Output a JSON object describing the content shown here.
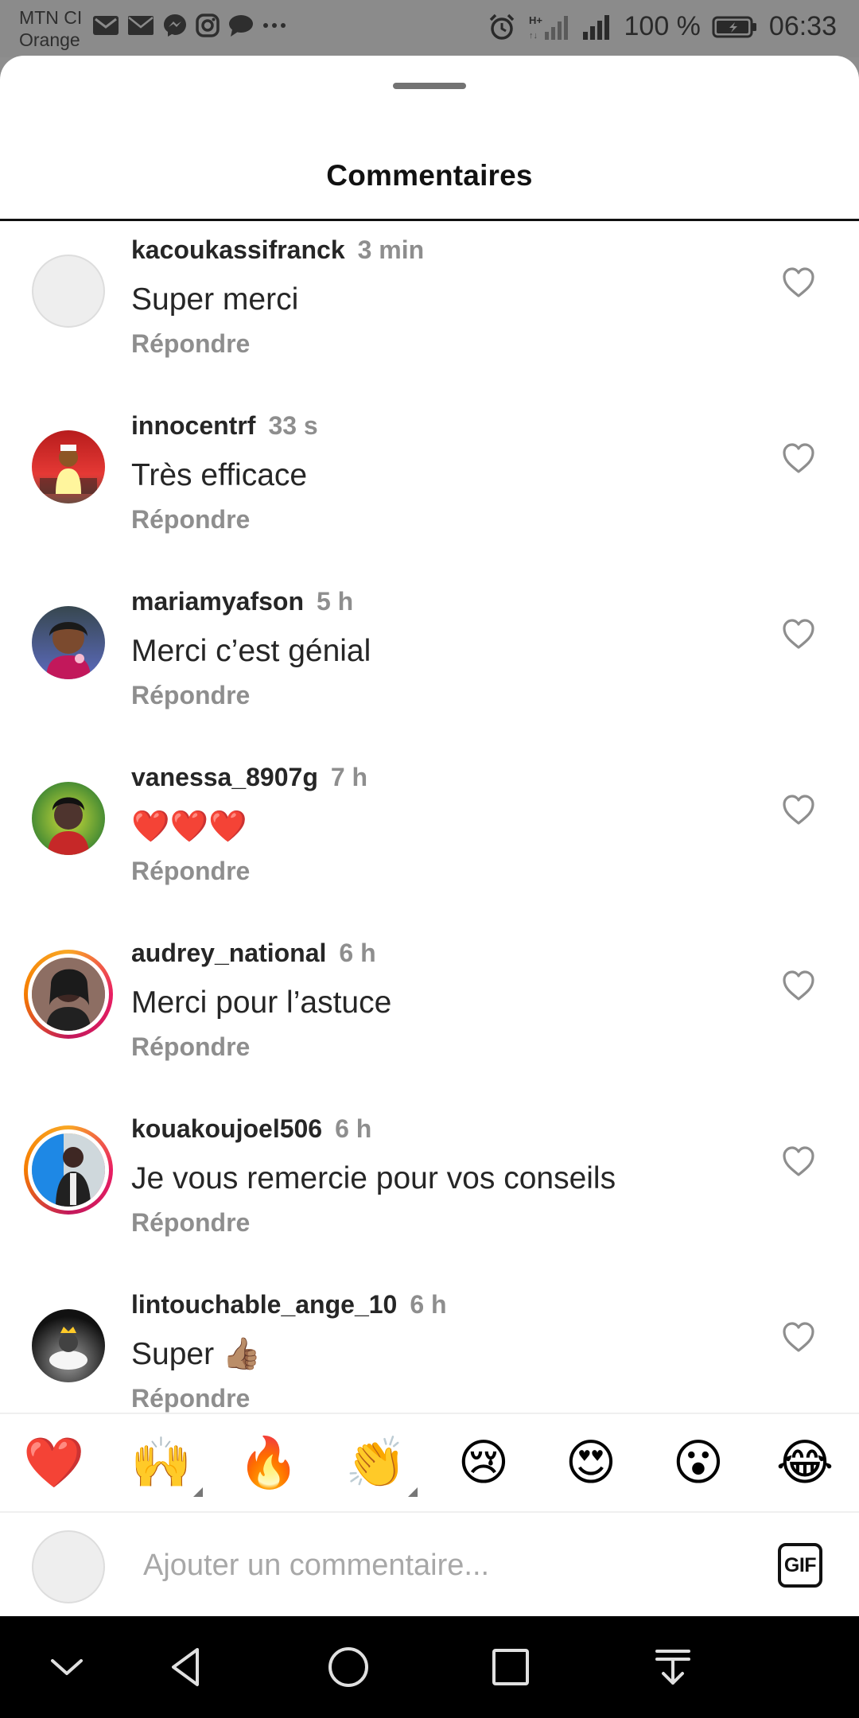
{
  "status_bar": {
    "carrier_line1": "MTN CI",
    "carrier_line2": "Orange",
    "battery_text": "100 %",
    "time": "06:33",
    "notification_icons": [
      "gmail-icon",
      "mail-icon",
      "messenger-icon",
      "instagram-icon",
      "chat-icon",
      "more-icon"
    ],
    "right_icons": [
      "alarm-icon",
      "signal-h-plus-icon",
      "signal-icon",
      "battery-icon"
    ]
  },
  "sheet": {
    "title": "Commentaires"
  },
  "comments": [
    {
      "username": "kacoukassifranck",
      "time": "3 min",
      "text": "Super merci",
      "reply": "Répondre",
      "avatar": "blank",
      "ring": false
    },
    {
      "username": "innocentrf",
      "time": "33 s",
      "text": "Très efficace",
      "reply": "Répondre",
      "avatar": "photo",
      "ring": false
    },
    {
      "username": "mariamyafson",
      "time": "5 h",
      "text": "Merci c’est génial",
      "reply": "Répondre",
      "avatar": "photo",
      "ring": false
    },
    {
      "username": "vanessa_8907g",
      "time": "7 h",
      "text": "❤️❤️❤️",
      "reply": "Répondre",
      "avatar": "photo",
      "ring": false
    },
    {
      "username": "audrey_national",
      "time": "6 h",
      "text": "Merci pour l’astuce",
      "reply": "Répondre",
      "avatar": "photo",
      "ring": true
    },
    {
      "username": "kouakoujoel506",
      "time": "6 h",
      "text": "Je vous remercie pour vos conseils",
      "reply": "Répondre",
      "avatar": "photo",
      "ring": true
    },
    {
      "username": "lintouchable_ange_10",
      "time": "6 h",
      "text": "Super 👍🏽",
      "reply": "Répondre",
      "avatar": "photo",
      "ring": false
    }
  ],
  "reactions": [
    "❤️",
    "🙌",
    "🔥",
    "👏",
    "😢",
    "😍",
    "😮",
    "😂"
  ],
  "composer": {
    "placeholder": "Ajouter un commentaire...",
    "gif_label": "GIF"
  },
  "nav_bar": {
    "buttons": [
      "hide-keyboard-icon",
      "back-icon",
      "home-icon",
      "recents-icon",
      "notification-pull-icon"
    ]
  }
}
